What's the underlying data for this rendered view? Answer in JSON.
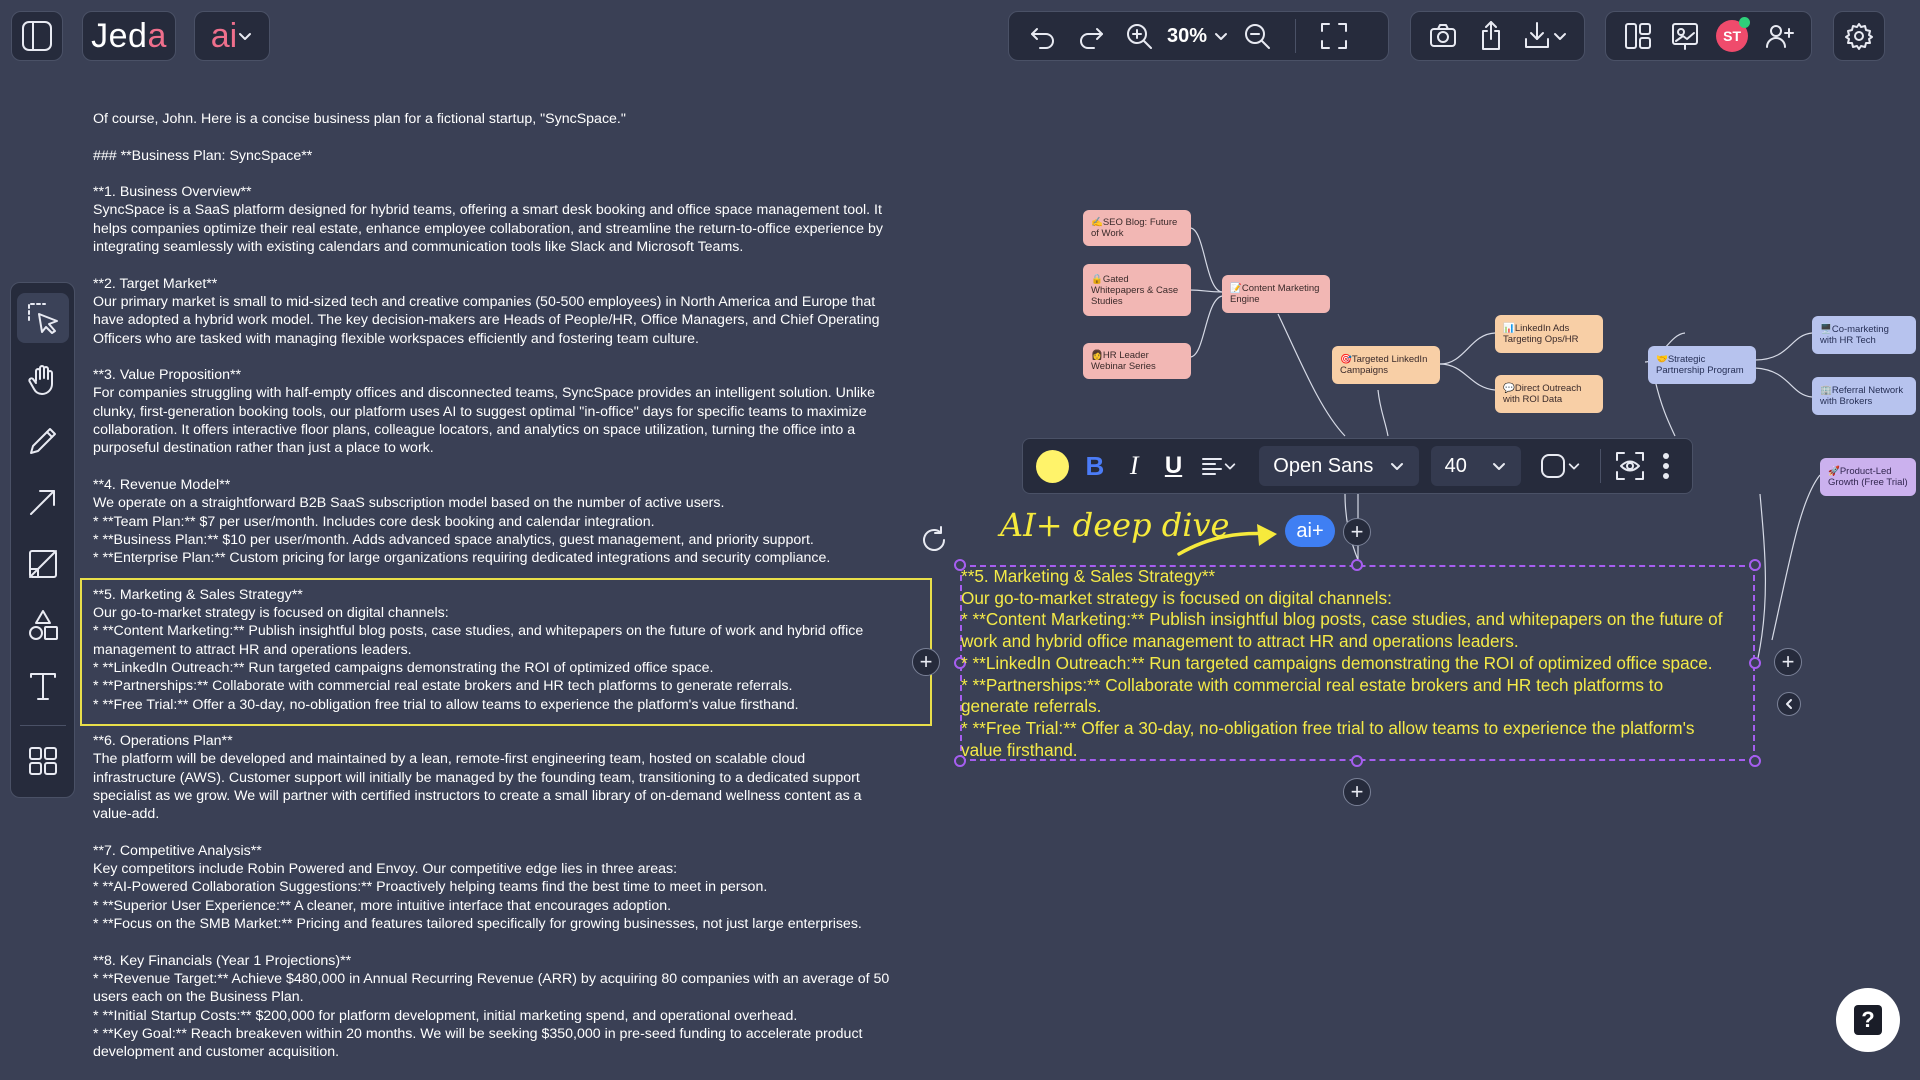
{
  "app": {
    "logo": "Jed",
    "logo_accent": "a",
    "ai_label": "ai"
  },
  "toolbar": {
    "zoom": "30%",
    "avatar_initials": "ST"
  },
  "format_bar": {
    "bold": "B",
    "italic": "I",
    "underline": "U",
    "font_family": "Open Sans",
    "font_size": "40",
    "text_color": "#fff36a"
  },
  "annotation": {
    "text": "AI+ deep dive",
    "ai_badge": "ai+"
  },
  "doc": {
    "paragraphs": [
      [
        "Of course, John. Here is a concise business plan for a fictional startup, \"SyncSpace.\""
      ],
      [
        "### **Business Plan: SyncSpace**"
      ],
      [
        "**1. Business Overview**",
        "SyncSpace is a SaaS platform designed for hybrid teams, offering a smart desk booking and office space management tool. It",
        "helps companies optimize their real estate, enhance employee collaboration, and streamline the return-to-office experience by",
        "integrating seamlessly with existing calendars and communication tools like Slack and Microsoft Teams."
      ],
      [
        "**2. Target Market**",
        "Our primary market is small to mid-sized tech and creative companies (50-500 employees) in North America and Europe that",
        "have adopted a hybrid work model. The key decision-makers are Heads of People/HR, Office Managers, and Chief Operating",
        "Officers who are tasked with managing flexible workspaces efficiently and fostering team culture."
      ],
      [
        "**3. Value Proposition**",
        "For companies struggling with half-empty offices and disconnected teams, SyncSpace provides an intelligent solution. Unlike",
        "clunky, first-generation booking tools, our platform uses AI to suggest optimal \"in-office\" days for specific teams to maximize",
        "collaboration. It offers interactive floor plans, colleague locators, and analytics on space utilization, turning the office into a",
        "purposeful destination rather than just a place to work."
      ],
      [
        "**4. Revenue Model**",
        "We operate on a straightforward B2B SaaS subscription model based on the number of active users.",
        "*   **Team Plan:** $7 per user/month. Includes core desk booking and calendar integration.",
        "*   **Business Plan:** $10 per user/month. Adds advanced space analytics, guest management, and priority support.",
        "*   **Enterprise Plan:** Custom pricing for large organizations requiring dedicated integrations and security compliance."
      ],
      [
        "**5. Marketing & Sales Strategy**",
        "Our go-to-market strategy is focused on digital channels:",
        "*   **Content Marketing:** Publish insightful blog posts, case studies, and whitepapers on the future of work and hybrid office",
        "management to attract HR and operations leaders.",
        "*   **LinkedIn Outreach:** Run targeted campaigns demonstrating the ROI of optimized office space.",
        "*   **Partnerships:** Collaborate with commercial real estate brokers and HR tech platforms to generate referrals.",
        "*   **Free Trial:** Offer a 30-day, no-obligation free trial to allow teams to experience the platform's value firsthand."
      ],
      [
        "**6. Operations Plan**",
        "The platform will be developed and maintained by a lean, remote-first engineering team, hosted on scalable cloud",
        "infrastructure (AWS). Customer support will initially be managed by the founding team, transitioning to a dedicated support",
        "specialist as we grow. We will partner with certified instructors to create a small library of on-demand wellness content as a",
        "value-add."
      ],
      [
        "**7. Competitive Analysis**",
        "Key competitors include Robin Powered and Envoy. Our competitive edge lies in three areas:",
        "*   **AI-Powered Collaboration Suggestions:** Proactively helping teams find the best time to meet in person.",
        "*   **Superior User Experience:** A cleaner, more intuitive interface that encourages adoption.",
        "*   **Focus on the SMB Market:** Pricing and features tailored specifically for growing businesses, not just large enterprises."
      ],
      [
        "**8. Key Financials (Year 1 Projections)**",
        "*   **Revenue Target:** Achieve $480,000 in Annual Recurring Revenue (ARR) by acquiring 80 companies with an average of 50",
        "users each on the Business Plan.",
        "*   **Initial Startup Costs:** $200,000 for platform development, initial marketing spend, and operational overhead.",
        "*   **Key Goal:** Reach breakeven within 20 months. We will be seeking $350,000 in pre-seed funding to accelerate product",
        "development and customer acquisition."
      ]
    ]
  },
  "selected_block": {
    "lines": [
      "**5. Marketing & Sales Strategy**",
      "Our go-to-market strategy is focused on digital channels:",
      "*   **Content Marketing:** Publish insightful blog posts, case studies, and whitepapers on the future of",
      "work and hybrid office management to attract HR and operations leaders.",
      "*   **LinkedIn Outreach:** Run targeted campaigns demonstrating the ROI of optimized office space.",
      "*   **Partnerships:** Collaborate with commercial real estate brokers and HR tech platforms to",
      "generate referrals.",
      "*   **Free Trial:** Offer a 30-day, no-obligation free trial to allow teams to experience the platform's",
      "value firsthand."
    ]
  },
  "mindmap": {
    "nodes": {
      "seo_blog": "✍️SEO Blog: Future of Work",
      "gated": "🔒Gated Whitepapers & Case Studies",
      "hr_webinar": "👩HR Leader Webinar Series",
      "content_engine": "📝Content Marketing Engine",
      "linkedin_campaigns": "🎯Targeted LinkedIn Campaigns",
      "linkedin_ads": "📊LinkedIn Ads Targeting Ops/HR",
      "direct_outreach": "💬Direct Outreach with ROI Data",
      "strategic_partnership": "🤝Strategic Partnership Program",
      "co_marketing": "🖥️Co-marketing with HR Tech",
      "referral": "🏢Referral Network with Brokers",
      "product_led": "🚀Product-Led Growth (Free Trial)"
    }
  }
}
